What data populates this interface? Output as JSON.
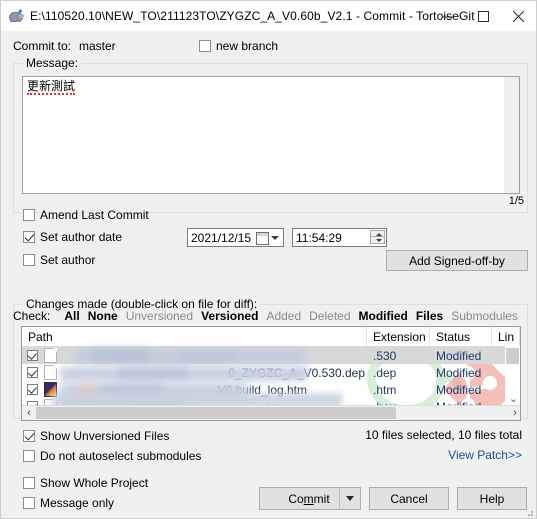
{
  "window": {
    "title": "E:\\110520.10\\NEW_TO\\211123TO\\ZYGZC_A_V0.60b_V2.1 - Commit - TortoiseGit",
    "icon": "tortoise-icon",
    "minimize": "—",
    "maximize": "□",
    "close": "✕"
  },
  "commit_to": {
    "label": "Commit to:",
    "branch": "master",
    "new_branch_label": "new branch",
    "new_branch_checked": false
  },
  "message": {
    "group_title": "Message:",
    "text": "更新測試",
    "counter": "1/5"
  },
  "options": {
    "amend_last_commit": {
      "label": "Amend Last Commit",
      "checked": false
    },
    "set_author_date": {
      "label": "Set author date",
      "checked": true
    },
    "set_author": {
      "label": "Set author",
      "checked": false
    },
    "date_value": "2021/12/15",
    "time_value": "11:54:29",
    "add_signed_off_by": "Add Signed-off-by"
  },
  "changes": {
    "group_title": "Changes made (double-click on file for diff):",
    "check_label": "Check:",
    "filters": [
      {
        "label": "All",
        "state": "bold"
      },
      {
        "label": "None",
        "state": "bold"
      },
      {
        "label": "Unversioned",
        "state": "disabled"
      },
      {
        "label": "Versioned",
        "state": "bold"
      },
      {
        "label": "Added",
        "state": "disabled"
      },
      {
        "label": "Deleted",
        "state": "disabled"
      },
      {
        "label": "Modified",
        "state": "bold"
      },
      {
        "label": "Files",
        "state": "bold"
      },
      {
        "label": "Submodules",
        "state": "disabled"
      }
    ],
    "columns": [
      "Path",
      "Extension",
      "Status",
      "Lin"
    ],
    "rows": [
      {
        "checked": true,
        "icon": "file-icon",
        "path": "",
        "extension": ".530",
        "status": "Modified",
        "lines": "",
        "selected": true,
        "redacted": true
      },
      {
        "checked": true,
        "icon": "file-icon",
        "path": "0_ZYGZC_A_V0.530.dep",
        "extension": ".dep",
        "status": "Modified",
        "lines": "",
        "selected": false,
        "redacted": true
      },
      {
        "checked": true,
        "icon": "html-file-icon",
        "path": "V0.build_log.htm",
        "extension": ".htm",
        "status": "Modified",
        "lines": "",
        "selected": false,
        "redacted": true
      },
      {
        "checked": true,
        "icon": "file-icon",
        "path": ".hex",
        "extension": ".hex",
        "status": "Modified",
        "lines": "",
        "selected": false,
        "redacted": true
      }
    ],
    "show_unversioned_files": {
      "label": "Show Unversioned Files",
      "checked": true
    },
    "do_not_autoselect_submodules": {
      "label": "Do not autoselect submodules",
      "checked": false
    },
    "file_count": "10 files selected, 10 files total",
    "view_patch": "View Patch>>"
  },
  "footer": {
    "show_whole_project": {
      "label": "Show Whole Project",
      "checked": false
    },
    "message_only": {
      "label": "Message only",
      "checked": false
    },
    "commit_button": {
      "prefix": "Co",
      "accel": "m",
      "suffix": "mit"
    },
    "cancel_button": "Cancel",
    "help_button": "Help"
  },
  "colors": {
    "window_bg": "#f0f0f0",
    "titlebar_bg": "#ffffff",
    "link": "#1f4e9c",
    "status_text": "#1d3a6e",
    "selection": "#d8d8d8",
    "spellcheck": "#e03030"
  }
}
